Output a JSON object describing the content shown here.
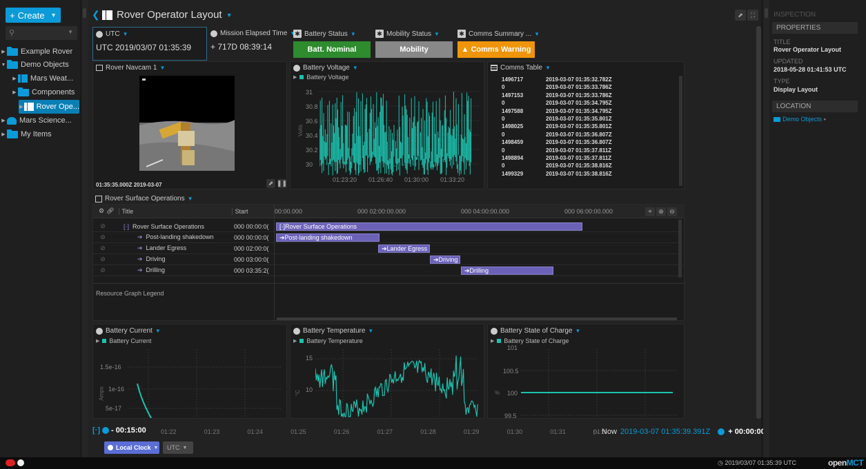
{
  "sidebar": {
    "create_label": "Create",
    "tree": [
      {
        "label": "Example Rover",
        "expanded": false
      },
      {
        "label": "Demo Objects",
        "expanded": true
      },
      {
        "label": "Mars Weat...",
        "expanded": false
      },
      {
        "label": "Components",
        "expanded": false
      },
      {
        "label": "Rover Ope...",
        "expanded": false,
        "selected": true
      },
      {
        "label": "Mars Science...",
        "expanded": false
      },
      {
        "label": "My Items",
        "expanded": false
      }
    ]
  },
  "header": {
    "title": "Rover Operator Layout"
  },
  "clocks": {
    "utc_label": "UTC",
    "utc_value": "UTC 2019/03/07 01:35:39",
    "met_label": "Mission Elapsed Time",
    "met_value": "+ 717D 08:39:14"
  },
  "status": {
    "battery_label": "Battery Status",
    "battery_value": "Batt. Nominal",
    "mobility_label": "Mobility Status",
    "mobility_value": "Mobility",
    "comms_label": "Comms Summary ...",
    "comms_value": "Comms Warning"
  },
  "navcam": {
    "title": "Rover Navcam 1",
    "timestamp": "01:35:35.000Z 2019-03-07"
  },
  "battery_voltage": {
    "title": "Battery Voltage",
    "legend": "Battery Voltage",
    "ylabel": "Volts",
    "yticks": [
      "31",
      "30.8",
      "30.6",
      "30.4",
      "30.2",
      "30"
    ],
    "xticks": [
      "01:23:20",
      "01:26:40",
      "01:30:00",
      "01:33:20"
    ]
  },
  "comms_table": {
    "title": "Comms Table",
    "rows": [
      [
        "1496717",
        "2019-03-07 01:35:32.782Z"
      ],
      [
        "0",
        "2019-03-07 01:35:33.786Z"
      ],
      [
        "1497153",
        "2019-03-07 01:35:33.786Z"
      ],
      [
        "0",
        "2019-03-07 01:35:34.795Z"
      ],
      [
        "1497588",
        "2019-03-07 01:35:34.795Z"
      ],
      [
        "0",
        "2019-03-07 01:35:35.801Z"
      ],
      [
        "1498025",
        "2019-03-07 01:35:35.801Z"
      ],
      [
        "0",
        "2019-03-07 01:35:36.807Z"
      ],
      [
        "1498459",
        "2019-03-07 01:35:36.807Z"
      ],
      [
        "0",
        "2019-03-07 01:35:37.811Z"
      ],
      [
        "1498894",
        "2019-03-07 01:35:37.811Z"
      ],
      [
        "0",
        "2019-03-07 01:35:38.816Z"
      ],
      [
        "1499329",
        "2019-03-07 01:35:38.816Z"
      ]
    ]
  },
  "timeline": {
    "title": "Rover Surface Operations",
    "col_title": "Title",
    "col_start": "Start",
    "ticks": [
      "00:00.000",
      "000 02:00:00.000",
      "000 04:00:00.000",
      "000 06:00:00.000"
    ],
    "rows": [
      {
        "title": "Rover Surface Operations",
        "start": "000 00:00:0(",
        "bar": "Rover Surface Operations"
      },
      {
        "title": "Post-landing shakedown",
        "start": "000 00:00:0(",
        "bar": "Post-landing shakedown"
      },
      {
        "title": "Lander Egress",
        "start": "000 02:00:0(",
        "bar": "Lander Egress"
      },
      {
        "title": "Driving",
        "start": "000 03:00:0(",
        "bar": "Driving"
      },
      {
        "title": "Drilling",
        "start": "000 03:35:2(",
        "bar": "Drilling"
      }
    ],
    "legend_label": "Resource Graph Legend"
  },
  "battery_current": {
    "title": "Battery Current",
    "legend": "Battery Current",
    "ylabel": "Amps",
    "yticks": [
      "1.5e-16",
      "1e-16",
      "5e-17"
    ]
  },
  "battery_temp": {
    "title": "Battery Temperature",
    "legend": "Battery Temperature",
    "ylabel": "°C",
    "yticks": [
      "15",
      "10"
    ]
  },
  "battery_soc": {
    "title": "Battery State of Charge",
    "legend": "Battery State of Charge",
    "ylabel": "%",
    "yticks": [
      "101",
      "100.5",
      "100",
      "99.5"
    ]
  },
  "time_conductor": {
    "duration": "- 00:15:00",
    "ticks": [
      "01:22",
      "01:23",
      "01:24",
      "01:25",
      "01:26",
      "01:27",
      "01:28",
      "01:29",
      "01:30",
      "01:31",
      "01:3"
    ],
    "now_label": "Now",
    "now_value": "2019-03-07 01:35:39.391Z",
    "offset": "+ 00:00:00",
    "clock_mode": "Local Clock",
    "time_system": "UTC"
  },
  "inspector": {
    "heading": "INSPECTION",
    "properties_label": "PROPERTIES",
    "title_label": "TITLE",
    "title_value": "Rover Operator Layout",
    "updated_label": "UPDATED",
    "updated_value": "2018-05-28 01:41:53 UTC",
    "type_label": "TYPE",
    "type_value": "Display Layout",
    "location_label": "LOCATION",
    "location_value": "Demo Objects"
  },
  "footer": {
    "clock": "2019/03/07 01:35:39 UTC",
    "brand_open": "open",
    "brand_mct": "MCT"
  },
  "colors": {
    "accent": "#0a9bd8",
    "plot_line": "#1bc3b0",
    "nominal": "#2e8b2e",
    "warning": "#f0950a",
    "timeline_bar": "#6b62b8"
  }
}
